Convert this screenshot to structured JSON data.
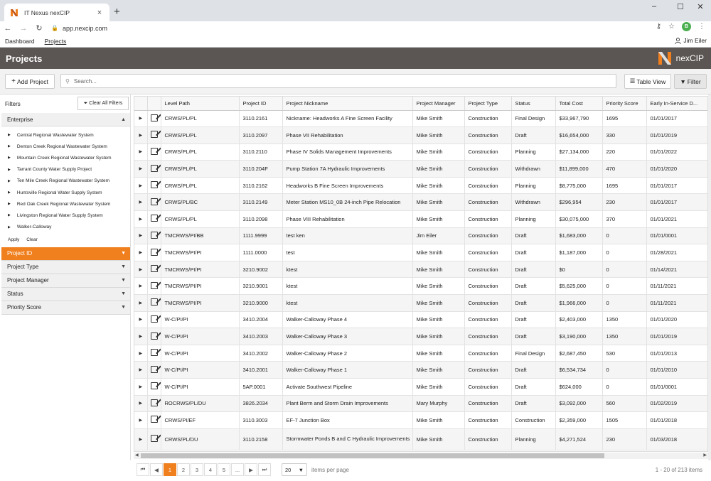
{
  "browser": {
    "tab_title": "IT Nexus nexCIP",
    "url": "app.nexcip.com",
    "profile_initial": "B"
  },
  "appnav": {
    "items": [
      {
        "label": "Dashboard"
      },
      {
        "label": "Projects"
      }
    ],
    "user": "Jim Eiler"
  },
  "header": {
    "title": "Projects",
    "brand": "nexCIP",
    "colors": {
      "bar": "#5b5653",
      "accent": "#f07f1e"
    }
  },
  "toolbar": {
    "add_label": "Add Project",
    "search_placeholder": "Search...",
    "table_view_label": "Table View",
    "filter_label": "Filter"
  },
  "filters": {
    "title": "Filters",
    "clear_all": "Clear All Filters",
    "enterprise": {
      "label": "Enterprise",
      "items": [
        "Central Regional Wastewater System",
        "Denton Creek Regional Wastewater System",
        "Mountain Creek Regional Wastewater System",
        "Tarrant County Water Supply Project",
        "Ten Mile Creek Regional Wastewater System",
        "Huntsville Regional Water Supply System",
        "Red Oak Creek Regional Wastewater System",
        "Livingston Regional Water Supply System",
        "Walker-Calloway"
      ],
      "apply": "Apply",
      "clear": "Clear"
    },
    "sections": [
      "Project ID",
      "Project Type",
      "Project Manager",
      "Status",
      "Priority Score"
    ]
  },
  "grid": {
    "columns": [
      "Level Path",
      "Project ID",
      "Project Nickname",
      "Project Manager",
      "Project Type",
      "Status",
      "Total Cost",
      "Priority Score",
      "Early In-Service D..."
    ],
    "rows": [
      [
        "CRWS/PL/PL",
        "3110.2161",
        "Nickname: Headworks A Fine Screen Facility",
        "Mike Smith",
        "Construction",
        "Final Design",
        "$33,967,790",
        "1695",
        "01/01/2017"
      ],
      [
        "CRWS/PL/PL",
        "3110.2097",
        "Phase VII Rehabilitation",
        "Mike Smith",
        "Construction",
        "Draft",
        "$16,654,000",
        "330",
        "01/01/2019"
      ],
      [
        "CRWS/PL/PL",
        "3110.2110",
        "Phase IV Solids Management Improvements",
        "Mike Smith",
        "Construction",
        "Planning",
        "$27,134,000",
        "220",
        "01/01/2022"
      ],
      [
        "CRWS/PL/PL",
        "3110.204F",
        "Pump Station 7A Hydraulic Improvements",
        "Mike Smith",
        "Construction",
        "Withdrawn",
        "$11,899,000",
        "470",
        "01/01/2020"
      ],
      [
        "CRWS/PL/PL",
        "3110.2162",
        "Headworks B Fine Screen Improvements",
        "Mike Smith",
        "Construction",
        "Planning",
        "$8,775,000",
        "1695",
        "01/01/2017"
      ],
      [
        "CRWS/PL/BC",
        "3110.2149",
        "Meter Station MS10_0B 24-inch Pipe Relocation",
        "Mike Smith",
        "Construction",
        "Withdrawn",
        "$296,954",
        "230",
        "01/01/2017"
      ],
      [
        "CRWS/PL/PL",
        "3110.2098",
        "Phase VIII Rehabilitation",
        "Mike Smith",
        "Construction",
        "Planning",
        "$30,075,000",
        "370",
        "01/01/2021"
      ],
      [
        "TMCRWS/PI/BB",
        "1111.9999",
        "test ken",
        "Jim Eiler",
        "Construction",
        "Draft",
        "$1,683,000",
        "0",
        "01/01/0001"
      ],
      [
        "TMCRWS/PI/PI",
        "1111.0000",
        "test",
        "Mike Smith",
        "Construction",
        "Draft",
        "$1,187,000",
        "0",
        "01/28/2021"
      ],
      [
        "TMCRWS/PI/PI",
        "3210.9002",
        "ktest",
        "Mike Smith",
        "Construction",
        "Draft",
        "$0",
        "0",
        "01/14/2021"
      ],
      [
        "TMCRWS/PI/PI",
        "3210.9001",
        "ktest",
        "Mike Smith",
        "Construction",
        "Draft",
        "$5,625,000",
        "0",
        "01/11/2021"
      ],
      [
        "TMCRWS/PI/PI",
        "3210.9000",
        "ktest",
        "Mike Smith",
        "Construction",
        "Draft",
        "$1,966,000",
        "0",
        "01/11/2021"
      ],
      [
        "W-C/PI/PI",
        "3410.2004",
        "Walker-Calloway Phase 4",
        "Mike Smith",
        "Construction",
        "Draft",
        "$2,403,000",
        "1350",
        "01/01/2020"
      ],
      [
        "W-C/PI/PI",
        "3410.2003",
        "Walker-Calloway Phase 3",
        "Mike Smith",
        "Construction",
        "Draft",
        "$3,190,000",
        "1350",
        "01/01/2019"
      ],
      [
        "W-C/PI/PI",
        "3410.2002",
        "Walker-Calloway Phase 2",
        "Mike Smith",
        "Construction",
        "Final Design",
        "$2,687,450",
        "530",
        "01/01/2013"
      ],
      [
        "W-C/PI/PI",
        "3410.2001",
        "Walker-Calloway Phase 1",
        "Mike Smith",
        "Construction",
        "Draft",
        "$6,534,734",
        "0",
        "01/01/2010"
      ],
      [
        "W-C/PI/PI",
        "5AP.0001",
        "Activate Southwest Pipeline",
        "Mike Smith",
        "Construction",
        "Draft",
        "$624,000",
        "0",
        "01/01/0001"
      ],
      [
        "ROCRWS/PL/DU",
        "3826.2034",
        "Plant Berm and Storm Drain Improvements",
        "Mary Murphy",
        "Construction",
        "Draft",
        "$3,092,000",
        "560",
        "01/02/2019"
      ],
      [
        "CRWS/PI/EF",
        "3110.3003",
        "EF-7 Junction Box",
        "Mike Smith",
        "Construction",
        "Construction",
        "$2,359,000",
        "1505",
        "01/01/2018"
      ],
      [
        "CRWS/PL/DU",
        "3110.2158",
        "Stormwater Ponds B and C Hydraulic Improvements",
        "Mike Smith",
        "Construction",
        "Planning",
        "$4,271,524",
        "230",
        "01/03/2018"
      ]
    ]
  },
  "pager": {
    "pages": [
      "1",
      "2",
      "3",
      "4",
      "5",
      "..."
    ],
    "current": "1",
    "per_page": "20",
    "per_page_label": "items per page",
    "info": "1 - 20 of 213 items"
  }
}
